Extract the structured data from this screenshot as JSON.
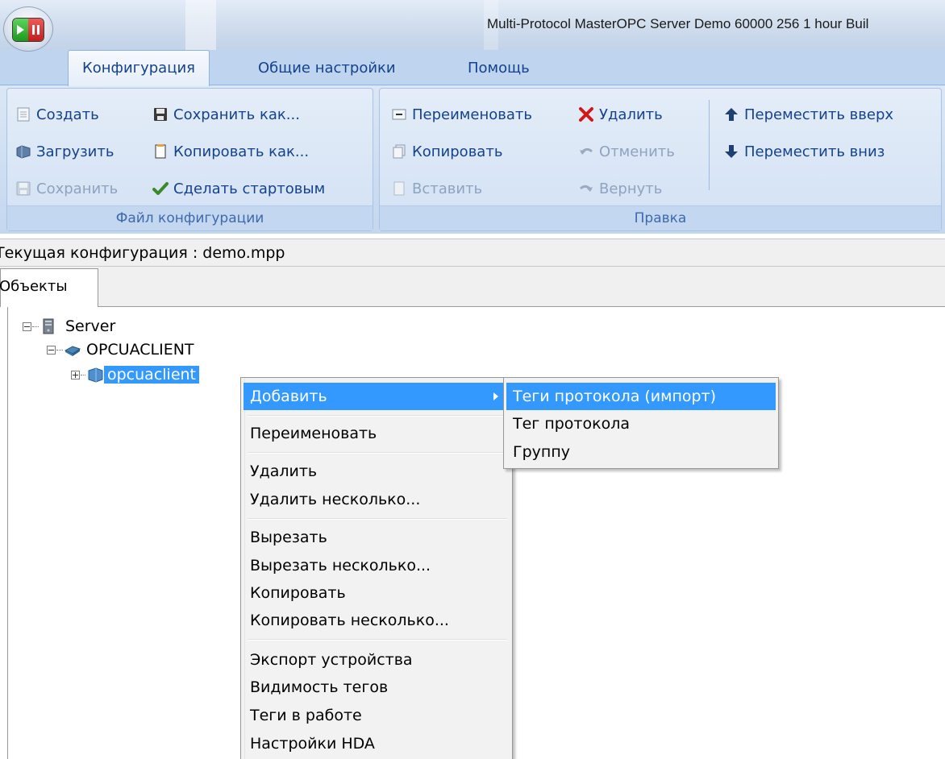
{
  "window": {
    "title": "Multi-Protocol MasterOPC Server Demo 60000 256 1 hour Buil"
  },
  "ribbon": {
    "tabs": [
      {
        "label": "Конфигурация",
        "active": true
      },
      {
        "label": "Общие настройки",
        "active": false
      },
      {
        "label": "Помощь",
        "active": false
      }
    ],
    "file_group": {
      "label": "Файл конфигурации",
      "create": "Создать",
      "load": "Загрузить",
      "save": "Сохранить",
      "save_as": "Сохранить как...",
      "copy_as": "Копировать как...",
      "make_startup": "Сделать стартовым"
    },
    "edit_group": {
      "label": "Правка",
      "rename": "Переименовать",
      "copy": "Копировать",
      "paste": "Вставить",
      "delete": "Удалить",
      "undo": "Отменить",
      "redo": "Вернуть",
      "move_up": "Переместить вверх",
      "move_down": "Переместить вниз"
    }
  },
  "status": {
    "current_config": "Текущая конфигурация : demo.mpp"
  },
  "objects_tab": {
    "label": "Объекты"
  },
  "tree": {
    "server": "Server",
    "opcuaclient_group": "OPCUACLIENT",
    "opcuaclient_device": "opcuaclient"
  },
  "context_menu": {
    "add": "Добавить",
    "rename": "Переименовать",
    "delete": "Удалить",
    "delete_multiple": "Удалить несколько...",
    "cut": "Вырезать",
    "cut_multiple": "Вырезать несколько...",
    "copy": "Копировать",
    "copy_multiple": "Копировать несколько...",
    "export_device": "Экспорт устройства",
    "tag_visibility": "Видимость тегов",
    "tags_in_work": "Теги в работе",
    "hda_settings": "Настройки HDA"
  },
  "submenu": {
    "protocol_tags_import": "Теги протокола (импорт)",
    "protocol_tag": "Тег протокола",
    "group": "Группу"
  },
  "colors": {
    "selection": "#3399ff",
    "ribbon_text": "#15428b",
    "ribbon_bg": "#cbdcf1"
  }
}
